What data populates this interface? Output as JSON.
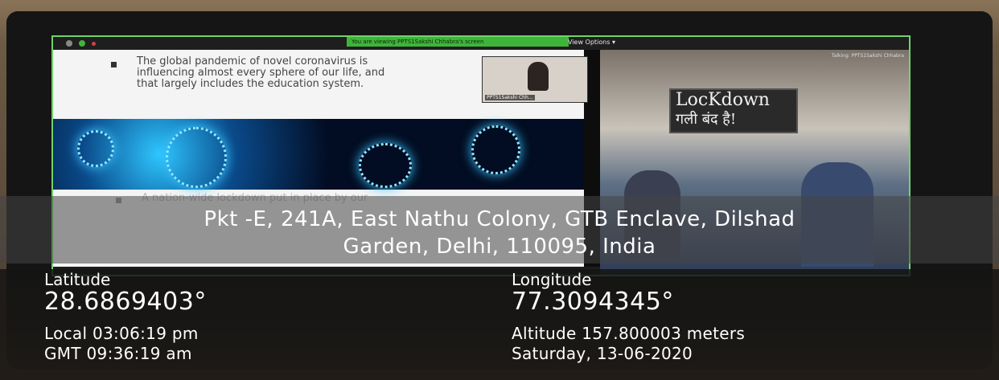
{
  "meeting": {
    "sharing_banner": "You are viewing PPTS1Sakshi Chhabra's screen",
    "view_options": "View Options ▾",
    "talking": "Talking: PPTS1Sakshi Chhabra",
    "participant_tile_name": "PPTS1Sakshi Chh..."
  },
  "slide": {
    "bullet1_line1": "The global pandemic of novel coronavirus is",
    "bullet1_line2": "influencing almost every sphere of our life, and",
    "bullet1_line3": "that largely includes the education system.",
    "bullet2_line1": "A nation-wide lockdown  put in place by our"
  },
  "photo": {
    "board_line1": "LocKdown",
    "board_line2": "गली बंद है!"
  },
  "geotag": {
    "address_line1": "Pkt -E, 241A, East Nathu Colony, GTB Enclave, Dilshad",
    "address_line2": "Garden, Delhi, 110095, India",
    "latitude_label": "Latitude",
    "latitude_value": "28.6869403°",
    "longitude_label": "Longitude",
    "longitude_value": "77.3094345°",
    "local_time": "Local 03:06:19 pm",
    "gmt_time": "GMT 09:36:19 am",
    "altitude": "Altitude 157.800003 meters",
    "date": "Saturday, 13-06-2020"
  },
  "colors": {
    "accent_green": "#3fb43a",
    "overlay_text": "#ffffff"
  }
}
